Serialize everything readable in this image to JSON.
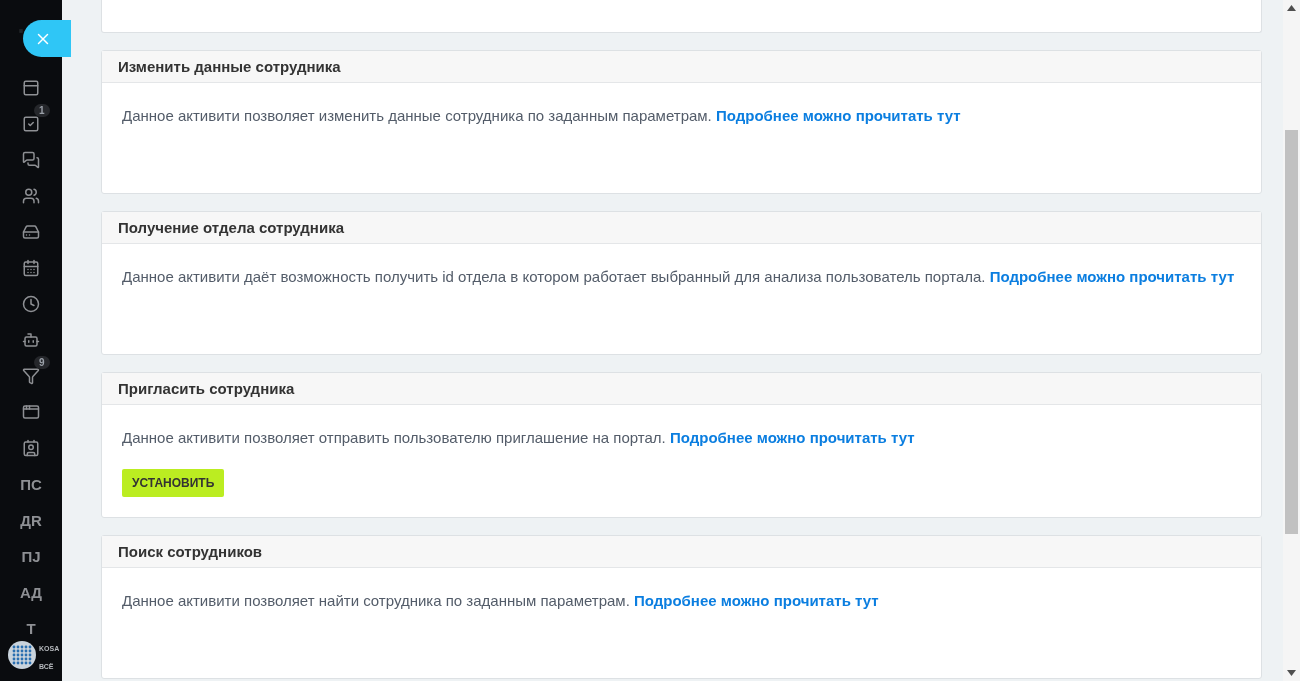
{
  "sidebar": {
    "items": [
      {
        "kind": "icon"
      },
      {
        "kind": "icon",
        "badge": "1"
      },
      {
        "kind": "icon"
      },
      {
        "kind": "icon"
      },
      {
        "kind": "icon"
      },
      {
        "kind": "icon"
      },
      {
        "kind": "icon"
      },
      {
        "kind": "icon"
      },
      {
        "kind": "icon",
        "badge": "9"
      },
      {
        "kind": "icon"
      },
      {
        "kind": "icon"
      },
      {
        "kind": "text",
        "label": "ПС"
      },
      {
        "kind": "text",
        "label": "ДR"
      },
      {
        "kind": "text",
        "label": "ПJ"
      },
      {
        "kind": "text",
        "label": "АД"
      },
      {
        "kind": "text",
        "label": "Т"
      }
    ],
    "logo": {
      "line1": "KOSA",
      "line2": "ВСЁ"
    }
  },
  "cards": [
    {
      "title": "Изменить данные сотрудника",
      "text": "Данное активити позволяет изменить данные сотрудника по заданным параметрам.",
      "link": "Подробнее можно прочитать тут"
    },
    {
      "title": "Получение отдела сотрудника",
      "text": "Данное активити даёт возможность получить id отдела в котором работает выбранный для анализа пользователь портала.",
      "link": "Подробнее можно прочитать тут"
    },
    {
      "title": "Пригласить сотрудника",
      "text": "Данное активити позволяет отправить пользователю приглашение на портал.",
      "link": "Подробнее можно прочитать тут",
      "button": "УСТАНОВИТЬ"
    },
    {
      "title": "Поиск сотрудников",
      "text": "Данное активити позволяет найти сотрудника по заданным параметрам.",
      "link": "Подробнее можно прочитать тут"
    }
  ]
}
